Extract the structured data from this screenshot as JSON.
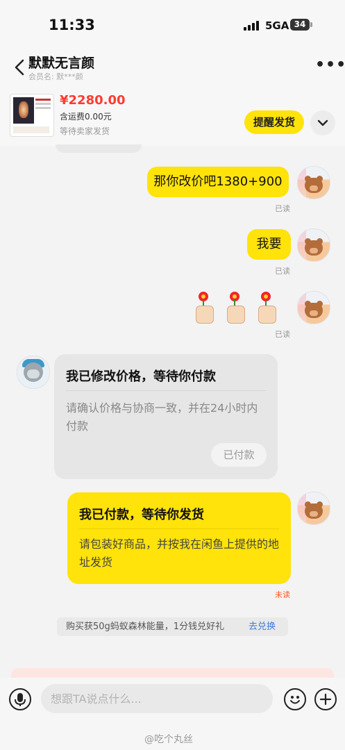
{
  "status_bar": {
    "time": "11:33",
    "network": "5GA",
    "battery": "34"
  },
  "header": {
    "contact_name": "默默无言颜",
    "member_label": "会员名:",
    "member_name": "默***颜"
  },
  "order": {
    "price": "¥2280.00",
    "shipping": "含运费0.00元",
    "status": "等待卖家发货",
    "remind_label": "提醒发货"
  },
  "messages": [
    {
      "text": "那你改价吧1380+900",
      "receipt": "已读"
    },
    {
      "text": "我要",
      "receipt": "已读"
    },
    {
      "sticker": "thumbs-up-flower",
      "count": 3,
      "receipt": "已读"
    }
  ],
  "price_card": {
    "title": "我已修改价格，等待你付款",
    "body": "请确认价格与协商一致，并在24小时内付款",
    "button": "已付款"
  },
  "paid_card": {
    "title": "我已付款，等待你发货",
    "body": "请包装好商品，并按我在闲鱼上提供的地址发货",
    "receipt": "未读"
  },
  "promo": {
    "text": "购买获50g蚂蚁森林能量，1分钱兑好礼",
    "link": "去兑换"
  },
  "input": {
    "placeholder": "想跟TA说点什么..."
  },
  "watermark": "@吃个丸丝",
  "colors": {
    "accent_yellow": "#ffe30a",
    "price_red": "#ff3b30",
    "unread_orange": "#ff5a1f",
    "link_blue": "#3d7bdc"
  }
}
